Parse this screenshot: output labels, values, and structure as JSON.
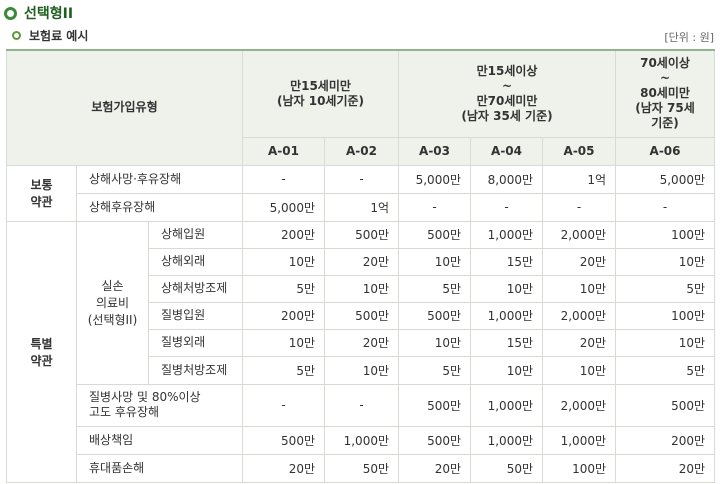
{
  "section_title": "선택형II",
  "subsection_title": "보험료 예시",
  "unit_note": "[단위 : 원]",
  "table": {
    "type_header": "보험가입유형",
    "age_groups": [
      {
        "line1": "만15세미만",
        "line2": "(남자 10세기준)"
      },
      {
        "line1": "만15세이상",
        "line2": "~",
        "line3": "만70세미만",
        "line4": "(남자 35세 기준)"
      },
      {
        "line1": "70세이상",
        "line2": "~",
        "line3": "80세미만",
        "line4": "(남자 75세",
        "line5": "기준)"
      }
    ],
    "plans": [
      "A-01",
      "A-02",
      "A-03",
      "A-04",
      "A-05",
      "A-06"
    ],
    "group_basic": {
      "line1": "보통",
      "line2": "약관"
    },
    "group_special": {
      "line1": "특별",
      "line2": "약관"
    },
    "medical_group": {
      "line1": "실손",
      "line2": "의료비",
      "line3": "(선택형II)"
    },
    "rows": [
      {
        "label": "상해사망·후유장해",
        "values": [
          "-",
          "-",
          "5,000만",
          "8,000만",
          "1억",
          "5,000만"
        ]
      },
      {
        "label": "상해후유장해",
        "values": [
          "5,000만",
          "1억",
          "-",
          "-",
          "-",
          "-"
        ]
      },
      {
        "label": "상해입원",
        "values": [
          "200만",
          "500만",
          "500만",
          "1,000만",
          "2,000만",
          "100만"
        ]
      },
      {
        "label": "상해외래",
        "values": [
          "10만",
          "20만",
          "10만",
          "15만",
          "20만",
          "10만"
        ]
      },
      {
        "label": "상해처방조제",
        "values": [
          "5만",
          "10만",
          "5만",
          "10만",
          "10만",
          "5만"
        ]
      },
      {
        "label": "질병입원",
        "values": [
          "200만",
          "500만",
          "500만",
          "1,000만",
          "2,000만",
          "100만"
        ]
      },
      {
        "label": "질병외래",
        "values": [
          "10만",
          "20만",
          "10만",
          "15만",
          "20만",
          "10만"
        ]
      },
      {
        "label": "질병처방조제",
        "values": [
          "5만",
          "10만",
          "5만",
          "10만",
          "10만",
          "5만"
        ]
      },
      {
        "label": "질병사망 및 80%이상",
        "label2": "고도 후유장해",
        "values": [
          "-",
          "-",
          "500만",
          "1,000만",
          "2,000만",
          "500만"
        ]
      },
      {
        "label": "배상책임",
        "values": [
          "500만",
          "1,000만",
          "500만",
          "1,000만",
          "1,000만",
          "200만"
        ]
      },
      {
        "label": "휴대품손해",
        "values": [
          "20만",
          "50만",
          "20만",
          "50만",
          "100만",
          "20만"
        ]
      }
    ]
  }
}
